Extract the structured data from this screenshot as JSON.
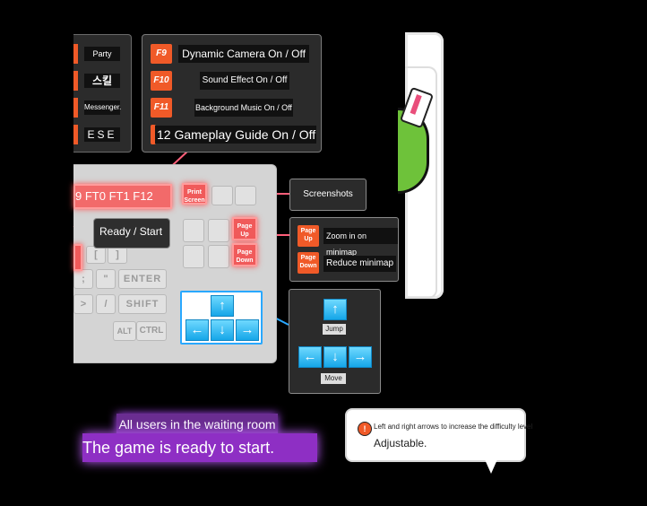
{
  "left_column": {
    "items": [
      {
        "label": "Party"
      },
      {
        "label": "스킬"
      },
      {
        "label": "Messenger."
      },
      {
        "label": "ESE"
      }
    ]
  },
  "fkeys": {
    "items": [
      {
        "key": "F9",
        "label": "Dynamic Camera On / Off"
      },
      {
        "key": "F10",
        "label": "Sound Effect On / Off"
      },
      {
        "key": "F11",
        "label": "Background Music On / Off"
      },
      {
        "key": "",
        "label": "12 Gameplay Guide On / Off"
      }
    ]
  },
  "keyboard": {
    "fstrip": "9 FT0 FT1 F12",
    "printscreen": "Print Screen",
    "pageup": "Page Up",
    "pagedown": "Page Down",
    "enter": "ENTER",
    "shift": "SHIFT",
    "alt": "ALT",
    "ctrl": "CTRL",
    "bracket_l": "[",
    "bracket_r": "]",
    "semicolon": ";",
    "quote": "\"",
    "greater": ">",
    "slash": "/",
    "arrow_up": "↑",
    "arrow_left": "←",
    "arrow_down": "↓",
    "arrow_right": "→"
  },
  "tooltips": {
    "ready_start": "Ready / Start",
    "screenshots": "Screenshots",
    "zoom_in_key": "Page Up",
    "zoom_in": "Zoom in on minimap",
    "reduce_key": "Page Down",
    "reduce": "Reduce minimap",
    "move_label_top": "Jump",
    "move_label": "Move"
  },
  "status": {
    "waiting": "All users in the waiting room",
    "ready": "The game is ready to start."
  },
  "tip": {
    "icon": "info-icon",
    "line1": "Left and right arrows to increase the difficulty level",
    "line2": "Adjustable."
  },
  "colors": {
    "accent_orange": "#f05a28",
    "key_red": "#f05a5a",
    "arrow_blue": "#16a6e8",
    "purple": "#8e2fc4"
  }
}
